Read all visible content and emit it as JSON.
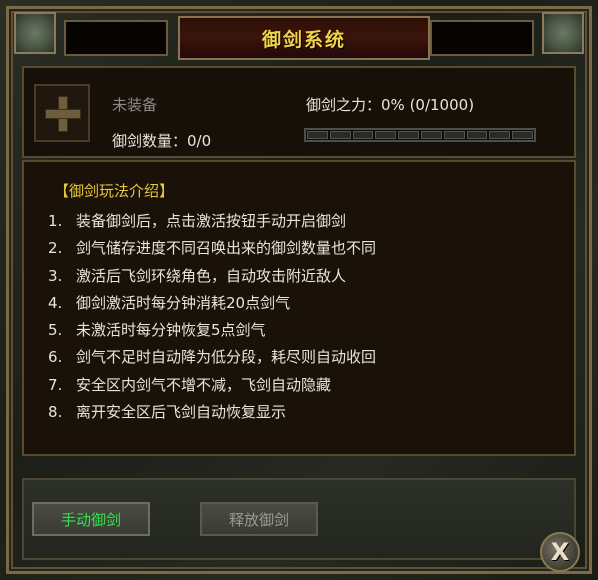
{
  "window": {
    "title": "御剑系统"
  },
  "equip": {
    "status": "未装备",
    "count_label": "御剑数量：0/0",
    "power_label": "御剑之力：0% (0/1000)",
    "power_progress": 0
  },
  "intro": {
    "title": "【御剑玩法介绍】",
    "rules": [
      {
        "num": "1.",
        "text": "装备御剑后，点击激活按钮手动开启御剑"
      },
      {
        "num": "2.",
        "text": "剑气储存进度不同召唤出来的御剑数量也不同"
      },
      {
        "num": "3.",
        "text": "激活后飞剑环绕角色，自动攻击附近敌人"
      },
      {
        "num": "4.",
        "text": "御剑激活时每分钟消耗20点剑气"
      },
      {
        "num": "5.",
        "text": "未激活时每分钟恢复5点剑气"
      },
      {
        "num": "6.",
        "text": "剑气不足时自动降为低分段，耗尽则自动收回"
      },
      {
        "num": "7.",
        "text": "安全区内剑气不增不减，飞剑自动隐藏"
      },
      {
        "num": "8.",
        "text": "离开安全区后飞剑自动恢复显示"
      }
    ]
  },
  "buttons": {
    "manual_label": "手动御剑",
    "release_label": "释放御剑",
    "close_label": "X"
  },
  "colors": {
    "title": "#f2d24a",
    "intro_title": "#e8c838",
    "active_button_text": "#36e04a"
  }
}
